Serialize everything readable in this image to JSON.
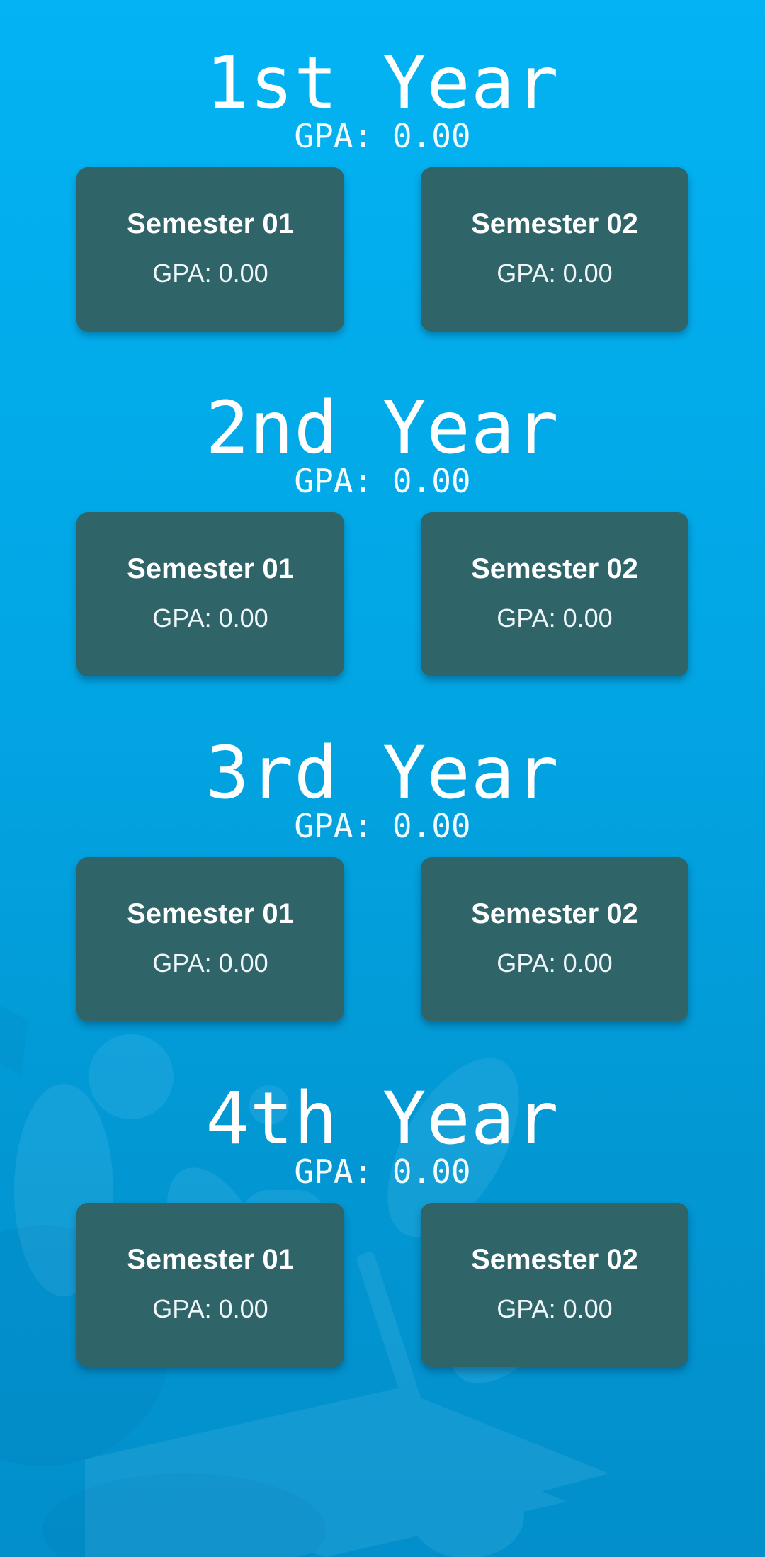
{
  "years": [
    {
      "title": "1st Year",
      "gpa": "GPA: 0.00",
      "semesters": [
        {
          "title": "Semester 01",
          "gpa": "GPA: 0.00"
        },
        {
          "title": "Semester 02",
          "gpa": "GPA: 0.00"
        }
      ]
    },
    {
      "title": "2nd Year",
      "gpa": "GPA: 0.00",
      "semesters": [
        {
          "title": "Semester 01",
          "gpa": "GPA: 0.00"
        },
        {
          "title": "Semester 02",
          "gpa": "GPA: 0.00"
        }
      ]
    },
    {
      "title": "3rd Year",
      "gpa": "GPA: 0.00",
      "semesters": [
        {
          "title": "Semester 01",
          "gpa": "GPA: 0.00"
        },
        {
          "title": "Semester 02",
          "gpa": "GPA: 0.00"
        }
      ]
    },
    {
      "title": "4th Year",
      "gpa": "GPA: 0.00",
      "semesters": [
        {
          "title": "Semester 01",
          "gpa": "GPA: 0.00"
        },
        {
          "title": "Semester 02",
          "gpa": "GPA: 0.00"
        }
      ]
    }
  ],
  "colors": {
    "background_top": "#03b3f3",
    "background_bottom": "#028fcb",
    "card": "#2f6469",
    "text": "#ffffff"
  },
  "icons": {
    "background": "study-illustration-icon"
  }
}
